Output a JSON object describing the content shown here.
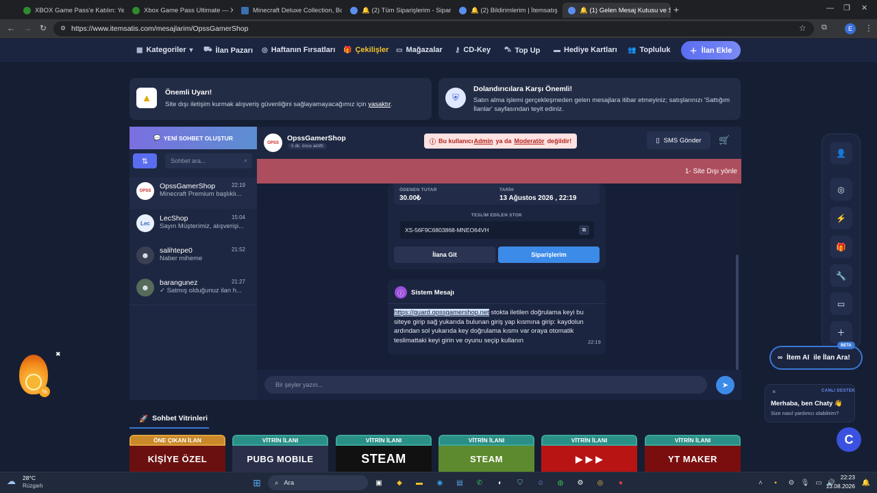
{
  "browser": {
    "tabs": [
      {
        "title": "XBOX Game Pass'e Katılın: Yeni",
        "color": "#2e8b2e"
      },
      {
        "title": "Xbox Game Pass Ultimate — Xb",
        "color": "#2e8b2e"
      },
      {
        "title": "Minecraft Deluxe Collection, Bo",
        "color": "#3a6fb0"
      },
      {
        "title": "🔔 (2) Tüm Siparişlerim - Sipar",
        "color": "#5a8ff0"
      },
      {
        "title": "🔔 (2) Bildirimlerim | İtemsatış",
        "color": "#5a8ff0"
      },
      {
        "title": "🔔 (1) Gelen Mesaj Kutusu ve S",
        "color": "#5a8ff0"
      }
    ],
    "url": "https://www.itemsatis.com/mesajlarim/OpssGamerShop",
    "profile_letter": "E"
  },
  "nav": {
    "items": [
      {
        "label": "Kategoriler",
        "icon": "grid-icon"
      },
      {
        "label": "İlan Pazarı",
        "icon": "basket-icon"
      },
      {
        "label": "Haftanın Fırsatları",
        "icon": "percent-icon"
      },
      {
        "label": "Çekilişler",
        "icon": "gift-icon"
      },
      {
        "label": "Mağazalar",
        "icon": "store-icon"
      },
      {
        "label": "CD-Key",
        "icon": "key-icon"
      },
      {
        "label": "Top Up",
        "icon": "cart-icon"
      },
      {
        "label": "Hediye Kartları",
        "icon": "card-icon"
      },
      {
        "label": "Topluluk",
        "icon": "users-icon"
      }
    ],
    "cta": "İlan Ekle",
    "accent": "#5a6df0",
    "highlight": "#f3c12b"
  },
  "warnings": {
    "left_title": "Önemli Uyarı!",
    "left_text": "Site dışı iletişim kurmak alışveriş güvenliğini sağlayamayacağımız için",
    "left_link": "yasaktır",
    "left_after": ".",
    "right_title": "Dolandırıcılara Karşı Önemli!",
    "right_text": "Satın alma işlemi gerçekleşmeden gelen mesajlara itibar etmeyiniz; satışlarınızı 'Sattığım İlanlar' sayfasından teyit ediniz."
  },
  "sidebar": {
    "new_chat": "YENİ SOHBET OLUŞTUR",
    "search_placeholder": "Sohbet ara...",
    "conversations": [
      {
        "name": "OpssGamerShop",
        "time": "22:19",
        "preview": "Minecraft Premium başlıklı..."
      },
      {
        "name": "LecShop",
        "time": "15:04",
        "preview": "Sayın Müşterimiz, alışverişi..."
      },
      {
        "name": "salihtepe0",
        "time": "21:52",
        "preview": "Naber miheme"
      },
      {
        "name": "barangunez",
        "time": "21:27",
        "preview": "✓ Satmış olduğunuz ilan h..."
      }
    ]
  },
  "chat": {
    "user": "OpssGamerShop",
    "last_seen": "5 dk. önce aktifti",
    "warning_prefix": "Bu kullanıcı ",
    "warning_admin": "Admin",
    "warning_mid": " ya da ",
    "warning_mod": "Moderatör",
    "warning_suffix": " değildir!",
    "sms": "SMS Gönder",
    "banner": "1- Site Dışı yönle",
    "order": {
      "paid_label": "ÖDENEN TUTAR",
      "paid_value": "30.00₺",
      "date_label": "TARİH",
      "date_value": "13 Ağustos 2026 , 22:19",
      "stock_label": "TESLİM EDİLEN STOK",
      "stock_value": "XS-56F9C6803868-MNEO64VH",
      "goto_listing": "İlana Git",
      "my_orders": "Siparişlerim"
    },
    "system": {
      "title": "Sistem Mesajı",
      "link": "https://guard.opssgamershop.net",
      "text": " stokta iletilen doğrulama keyi bu siteye girip sağ yukarıda bulunan giriş yap kısmına girip: kaydolun ardından sol yukarıda key doğrulama kısmı var oraya otomatik teslimattaki keyi girin ve oyunu seçip kullanın",
      "time": "22:19"
    },
    "composer_placeholder": "Bir şeyler yazın..."
  },
  "rail": {
    "icons": [
      "user-icon",
      "instagram-icon",
      "bolt-icon",
      "gift-icon",
      "wrench-icon",
      "window-icon",
      "plus-icon"
    ]
  },
  "ai": {
    "badge": "BETA",
    "brand": "İtem AI",
    "text": "ile İlan Ara!"
  },
  "chaty": {
    "label": "CANLI DESTEK",
    "title": "Merhaba, ben Chaty 👋",
    "subtitle": "Size nasıl yardımcı olabilirim?",
    "close": "×"
  },
  "showcase": {
    "heading": "Sohbet Vitrinleri",
    "items": [
      {
        "label": "ÖNE ÇIKAN İLAN",
        "art": "KİŞİYE ÖZEL",
        "bg": "#6a1010",
        "lbl_bg": "#c9892a"
      },
      {
        "label": "VİTRİN İLANI",
        "art": "PUBG MOBILE",
        "bg": "#2a2f4a",
        "lbl_bg": "#2a8f86"
      },
      {
        "label": "VİTRİN İLANI",
        "art": "STEAM",
        "bg": "#111",
        "lbl_bg": "#2a8f86"
      },
      {
        "label": "VİTRİN İLANI",
        "art": "STEAM",
        "bg": "#5d8a2e",
        "lbl_bg": "#2a8f86"
      },
      {
        "label": "VİTRİN İLANI",
        "art": "▶ ▶ ▶",
        "bg": "#b81414",
        "lbl_bg": "#2a8f86"
      },
      {
        "label": "VİTRİN İLANI",
        "art": "YT MAKER",
        "bg": "#7a0e0e",
        "lbl_bg": "#2a8f86"
      }
    ]
  },
  "taskbar": {
    "weather_temp": "28°C",
    "weather_desc": "Rüzgarlı",
    "search": "Ara",
    "time": "22:23",
    "date": "13.08.2026"
  }
}
